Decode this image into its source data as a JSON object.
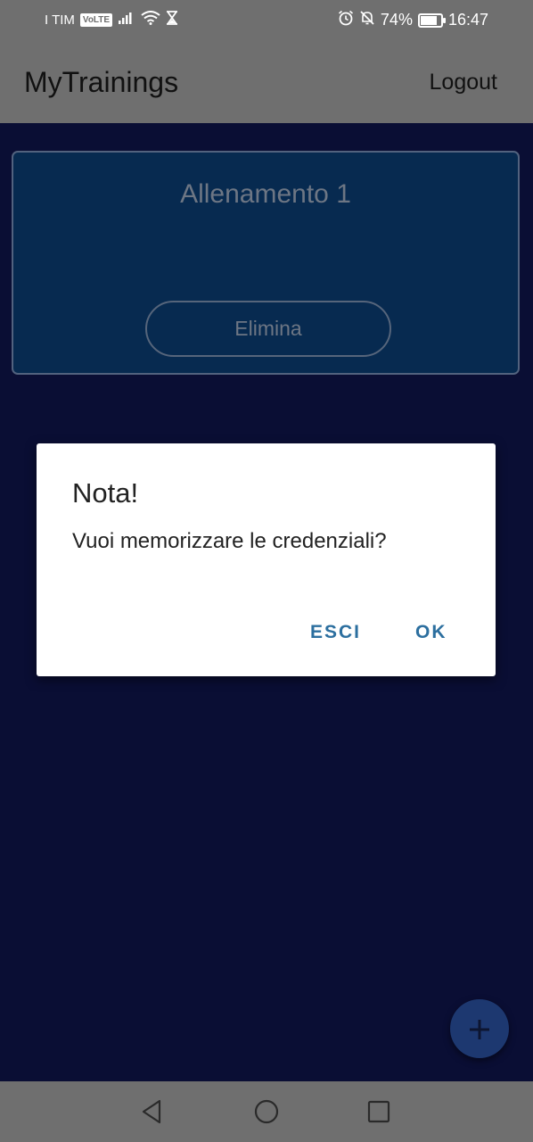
{
  "status_bar": {
    "carrier": "I TIM",
    "volte": "VoLTE",
    "battery_percent": "74%",
    "battery_level": 0.74,
    "time": "16:47",
    "icons": [
      "signal-icon",
      "wifi-icon",
      "hourglass-icon",
      "alarm-icon",
      "bell-off-icon",
      "battery-icon"
    ]
  },
  "app_bar": {
    "title": "MyTrainings",
    "logout_label": "Logout"
  },
  "training_card": {
    "title": "Allenamento 1",
    "delete_label": "Elimina"
  },
  "dialog": {
    "title": "Nota!",
    "message": "Vuoi memorizzare le credenziali?",
    "cancel_label": "ESCI",
    "ok_label": "OK"
  },
  "fab": {
    "icon": "plus-icon",
    "label": "+"
  },
  "nav_bar": {
    "icons": [
      "back-icon",
      "home-icon",
      "recent-apps-icon"
    ]
  },
  "colors": {
    "background": "#0a0e34",
    "app_bar": "#6f6f6f",
    "card": "#072a50",
    "accent": "#2c6f9f",
    "fab": "#1d3870"
  }
}
